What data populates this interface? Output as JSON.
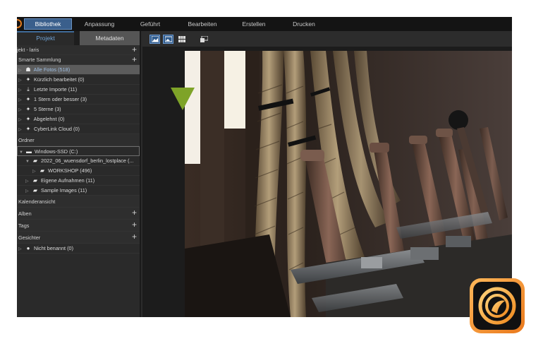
{
  "menu": {
    "tabs": [
      {
        "label": "Bibliothek"
      },
      {
        "label": "Anpassung"
      },
      {
        "label": "Geführt"
      },
      {
        "label": "Bearbeiten"
      },
      {
        "label": "Erstellen"
      },
      {
        "label": "Drucken"
      }
    ]
  },
  "left_panel": {
    "tabs": [
      {
        "label": "Projekt"
      },
      {
        "label": "Metadaten"
      }
    ],
    "project_row": "jekt - laris",
    "smart_header": "Smarte Sammlung",
    "smart_items": [
      {
        "label": "Alle Fotos (518)"
      },
      {
        "label": "Kürzlich bearbeitet (0)"
      },
      {
        "label": "Letzte Importe (11)"
      },
      {
        "label": "1 Stern oder besser (3)"
      },
      {
        "label": "5 Sterne (3)"
      },
      {
        "label": "Abgelehnt (0)"
      },
      {
        "label": "CyberLink Cloud (0)"
      }
    ],
    "folder_header": "Ordner",
    "folders": [
      {
        "label": "Windows-SSD (C:)"
      },
      {
        "label": "2022_06_wuensdorf_berlin_lostplace (..."
      },
      {
        "label": "WORKSHOP (496)"
      },
      {
        "label": "Eigene Aufnahmen (11)"
      },
      {
        "label": "Sample Images (11)"
      }
    ],
    "calendar_header": "Kalenderansicht",
    "albums_header": "Alben",
    "tags_header": "Tags",
    "faces_header": "Gesichter",
    "faces_items": [
      {
        "label": "Nicht benannt (0)"
      }
    ],
    "plus": "+"
  },
  "colors": {
    "accent_blue": "#3a5f8c",
    "indicator_green": "#7ea328",
    "badge_orange": "#e9781b"
  },
  "icons": {
    "smart_collection": "sparkle-icon",
    "folder": "folder-icon",
    "drive": "drive-icon",
    "person": "person-icon"
  }
}
